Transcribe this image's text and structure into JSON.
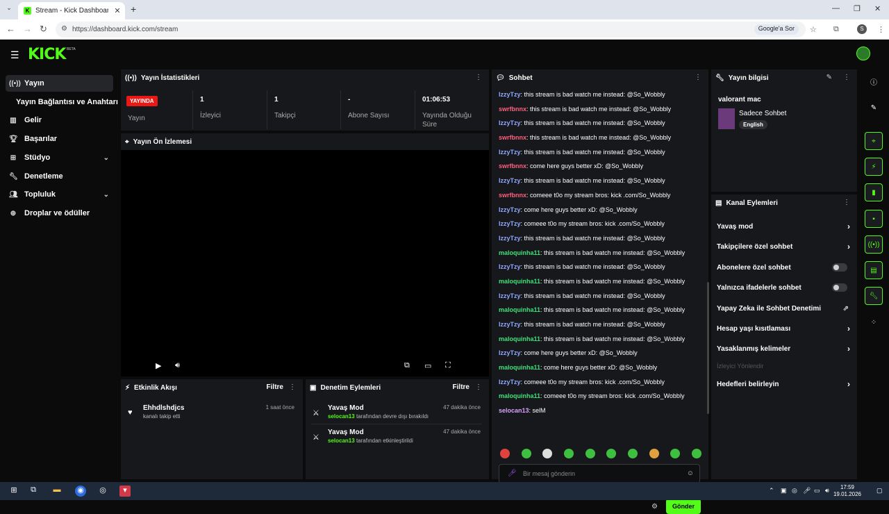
{
  "browser": {
    "tab_title": "Stream - Kick Dashboard",
    "url": "https://dashboard.kick.com/stream",
    "ask_google": "Google'a Sor",
    "profile_letter": "S"
  },
  "sidebar": {
    "items": [
      {
        "label": "Yayın",
        "icon": "broadcast-icon"
      },
      {
        "label": "Yayın Bağlantısı ve Anahtarı",
        "icon": ""
      },
      {
        "label": "Gelir",
        "icon": "chart-icon"
      },
      {
        "label": "Başarılar",
        "icon": "trophy-icon"
      },
      {
        "label": "Stüdyo",
        "icon": "studio-icon"
      },
      {
        "label": "Denetleme",
        "icon": "wrench-icon"
      },
      {
        "label": "Topluluk",
        "icon": "community-icon"
      },
      {
        "label": "Droplar ve ödüller",
        "icon": "gift-icon"
      }
    ]
  },
  "stats": {
    "title": "Yayın İstatistikleri",
    "live_badge": "YAYINDA",
    "live_label": "Yayın",
    "cells": [
      {
        "value": "1",
        "label": "İzleyici"
      },
      {
        "value": "1",
        "label": "Takipçi"
      },
      {
        "value": "-",
        "label": "Abone Sayısı"
      },
      {
        "value": "01:06:53",
        "label": "Yayında Olduğu Süre"
      }
    ]
  },
  "preview": {
    "title": "Yayın Ön İzlemesi"
  },
  "activity": {
    "title": "Etkinlik Akışı",
    "filter": "Filtre",
    "events": [
      {
        "title": "Ehhdlshdjcs",
        "sub": "kanalı takip etti",
        "time": "1 saat önce"
      }
    ]
  },
  "moderation": {
    "title": "Denetim Eylemleri",
    "filter": "Filtre",
    "events": [
      {
        "title": "Yavaş Mod",
        "user": "selocan13",
        "sub": "tarafından devre dışı bırakıldı",
        "time": "47 dakika önce"
      },
      {
        "title": "Yavaş Mod",
        "user": "selocan13",
        "sub": "tarafından etkinleştirildi",
        "time": "47 dakika önce"
      }
    ]
  },
  "chat": {
    "title": "Sohbet",
    "placeholder": "Bir mesaj gönderin",
    "send": "Gönder",
    "messages": [
      {
        "user": "IzzyTzy",
        "color": "#8fa8ff",
        "text": ": this stream is bad watch me instead: @So_Wobbly"
      },
      {
        "user": "swrfbnnx",
        "color": "#ff5f7e",
        "text": ": this stream is bad watch me instead: @So_Wobbly"
      },
      {
        "user": "IzzyTzy",
        "color": "#8fa8ff",
        "text": ": this stream is bad watch me instead: @So_Wobbly"
      },
      {
        "user": "swrfbnnx",
        "color": "#ff5f7e",
        "text": ": this stream is bad watch me instead: @So_Wobbly"
      },
      {
        "user": "IzzyTzy",
        "color": "#8fa8ff",
        "text": ": this stream is bad watch me instead: @So_Wobbly"
      },
      {
        "user": "swrfbnnx",
        "color": "#ff5f7e",
        "text": ": come here guys better xD: @So_Wobbly"
      },
      {
        "user": "IzzyTzy",
        "color": "#8fa8ff",
        "text": ": this stream is bad watch me instead: @So_Wobbly"
      },
      {
        "user": "swrfbnnx",
        "color": "#ff5f7e",
        "text": ": comeee t0o my stream bros: kick .com/So_Wobbly"
      },
      {
        "user": "IzzyTzy",
        "color": "#8fa8ff",
        "text": ": come here guys better xD: @So_Wobbly"
      },
      {
        "user": "IzzyTzy",
        "color": "#8fa8ff",
        "text": ": comeee t0o my stream bros: kick .com/So_Wobbly"
      },
      {
        "user": "IzzyTzy",
        "color": "#8fa8ff",
        "text": ": this stream is bad watch me instead: @So_Wobbly"
      },
      {
        "user": "maloquinha11",
        "color": "#3ee07a",
        "text": ": this stream is bad watch me instead: @So_Wobbly"
      },
      {
        "user": "IzzyTzy",
        "color": "#8fa8ff",
        "text": ": this stream is bad watch me instead: @So_Wobbly"
      },
      {
        "user": "maloquinha11",
        "color": "#3ee07a",
        "text": ": this stream is bad watch me instead: @So_Wobbly"
      },
      {
        "user": "IzzyTzy",
        "color": "#8fa8ff",
        "text": ": this stream is bad watch me instead: @So_Wobbly"
      },
      {
        "user": "maloquinha11",
        "color": "#3ee07a",
        "text": ": this stream is bad watch me instead: @So_Wobbly"
      },
      {
        "user": "IzzyTzy",
        "color": "#8fa8ff",
        "text": ": this stream is bad watch me instead: @So_Wobbly"
      },
      {
        "user": "maloquinha11",
        "color": "#3ee07a",
        "text": ": this stream is bad watch me instead: @So_Wobbly"
      },
      {
        "user": "IzzyTzy",
        "color": "#8fa8ff",
        "text": ": come here guys better xD: @So_Wobbly"
      },
      {
        "user": "maloquinha11",
        "color": "#3ee07a",
        "text": ": come here guys better xD: @So_Wobbly"
      },
      {
        "user": "IzzyTzy",
        "color": "#8fa8ff",
        "text": ": comeee t0o my stream bros: kick .com/So_Wobbly"
      },
      {
        "user": "maloquinha11",
        "color": "#3ee07a",
        "text": ": comeee t0o my stream bros: kick .com/So_Wobbly"
      },
      {
        "user": "selocan13",
        "color": "#d9a2ff",
        "text": ": selM"
      }
    ]
  },
  "info": {
    "title": "Yayın bilgisi",
    "stream_title": "valorant mac",
    "category": "Sadece Sohbet",
    "language": "English"
  },
  "actions": {
    "title": "Kanal Eylemleri",
    "items": [
      {
        "label": "Yavaş mod",
        "kind": "chevron"
      },
      {
        "label": "Takipçilere özel sohbet",
        "kind": "chevron"
      },
      {
        "label": "Abonelere özel sohbet",
        "kind": "toggle"
      },
      {
        "label": "Yalnızca ifadelerle sohbet",
        "kind": "toggle"
      },
      {
        "label": "Yapay Zeka ile Sohbet Denetimi",
        "kind": "external"
      },
      {
        "label": "Hesap yaşı kısıtlaması",
        "kind": "chevron"
      },
      {
        "label": "Yasaklanmış kelimeler",
        "kind": "chevron"
      },
      {
        "label": "İzleyici Yönlendir",
        "kind": "disabled"
      },
      {
        "label": "Hedefleri belirleyin",
        "kind": "chevron"
      }
    ]
  },
  "taskbar": {
    "time": "17:59",
    "date": "19.01.2026"
  },
  "colors": {
    "accent": "#53fc18",
    "live": "#e91916"
  }
}
